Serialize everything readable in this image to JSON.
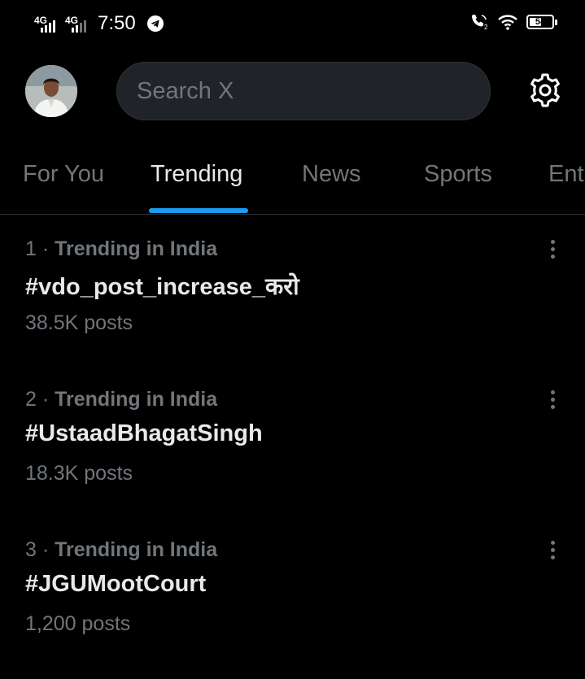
{
  "status_bar": {
    "network_1": "4G",
    "network_2": "4G",
    "time": "7:50",
    "battery": "54",
    "battery_level": 0.54
  },
  "header": {
    "search_placeholder": "Search X"
  },
  "tabs": [
    {
      "label": "For You",
      "active": false
    },
    {
      "label": "Trending",
      "active": true
    },
    {
      "label": "News",
      "active": false
    },
    {
      "label": "Sports",
      "active": false
    },
    {
      "label": "Ent",
      "active": false
    }
  ],
  "trends": [
    {
      "rank": "1 · ",
      "context": "Trending in India",
      "name": "#vdo_post_increase_करो",
      "posts": "38.5K posts"
    },
    {
      "rank": "2 · ",
      "context": "Trending in India",
      "name": "#UstaadBhagatSingh",
      "posts": "18.3K posts"
    },
    {
      "rank": "3 · ",
      "context": "Trending in India",
      "name": "#JGUMootCourt",
      "posts": "1,200 posts"
    }
  ],
  "colors": {
    "background": "#000000",
    "accent": "#1d9bf0",
    "text_primary": "#e7e9ea",
    "text_secondary": "#71767b",
    "search_bg": "#202327"
  }
}
